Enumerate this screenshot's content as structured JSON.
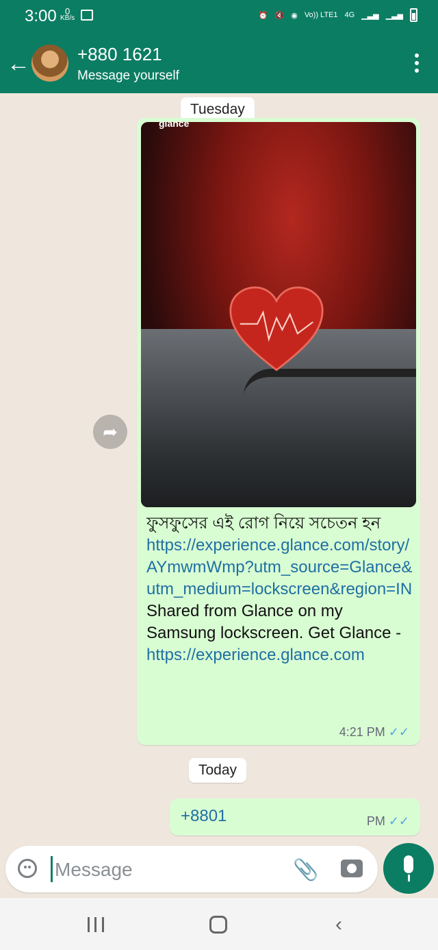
{
  "status_bar": {
    "time": "3:00",
    "net_speed_value": "0",
    "net_speed_unit": "KB/s",
    "volte": "Vo)) LTE1",
    "network": "4G"
  },
  "header": {
    "title": "+880 1621",
    "subtitle": "Message yourself"
  },
  "chat": {
    "date_tuesday": "Tuesday",
    "date_today": "Today",
    "message1": {
      "image_label": "glance",
      "text_bengali": "ফুসফুসের এই রোগ নিয়ে সচেতন হন",
      "link1": "https://experience.glance.com/story/AYmwmWmp?utm_source=Glance&utm_medium=lockscreen&region=IN",
      "shared_text": "Shared from Glance on my Samsung lockscreen. Get Glance - ",
      "link2": "https://experience.glance.com",
      "time": "4:21 PM",
      "ticks": "✓✓"
    },
    "message2": {
      "text": "+8801",
      "time": "PM",
      "ticks": "✓✓"
    }
  },
  "composer": {
    "placeholder": "Message"
  },
  "colors": {
    "primary": "#0b7d63",
    "outgoing_bubble": "#d9fdd3",
    "chat_bg": "#efe7de",
    "link": "#1f6fa3",
    "read_ticks": "#4ea9e8"
  }
}
